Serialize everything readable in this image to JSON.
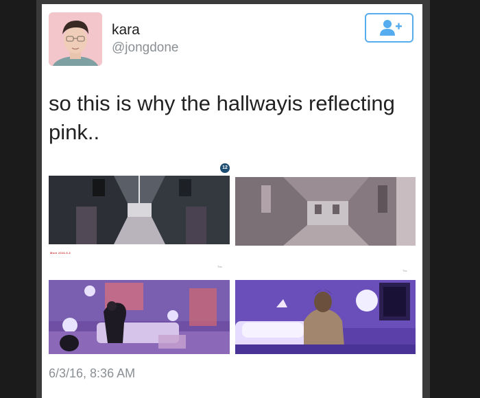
{
  "user": {
    "name": "kara",
    "handle": "@jongdone"
  },
  "tweet": {
    "text": "so this is why the hallwayis reflecting pink.."
  },
  "media": {
    "badge": "12",
    "caption_logo": "Mnet 2016.6.3",
    "mark_top_right": "Tbc",
    "mark_bottom_right": "Tbc"
  },
  "icons": {
    "follow": "add-user-icon"
  },
  "colors": {
    "accent": "#55acee",
    "follow_button_border": "#55acee"
  },
  "timestamp": "6/3/16, 8:36 AM"
}
